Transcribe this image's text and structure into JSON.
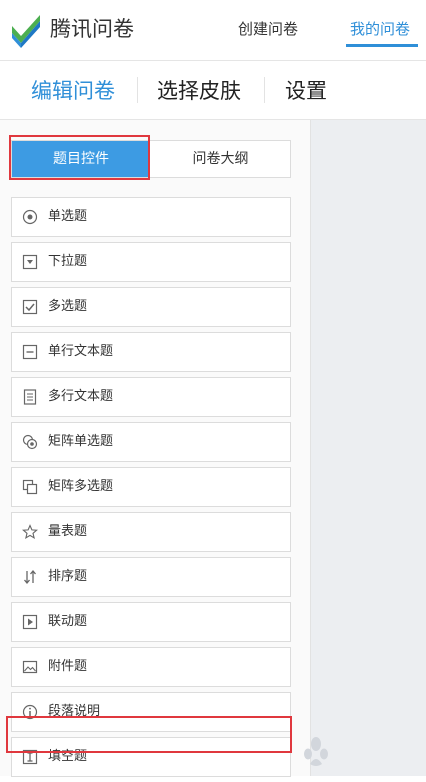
{
  "header": {
    "brand": "腾讯问卷",
    "nav_create": "创建问卷",
    "nav_my": "我的问卷",
    "accent": "#2f8fd8"
  },
  "tabs": [
    {
      "label": "编辑问卷",
      "active": true
    },
    {
      "label": "选择皮肤",
      "active": false
    },
    {
      "label": "设置",
      "active": false
    }
  ],
  "panel_toggle": {
    "active_label": "题目控件",
    "inactive_label": "问卷大纲",
    "active_color": "#3d9be3"
  },
  "question_types": [
    {
      "label": "单选题",
      "icon": "radio-icon"
    },
    {
      "label": "下拉题",
      "icon": "dropdown-icon"
    },
    {
      "label": "多选题",
      "icon": "checkbox-icon"
    },
    {
      "label": "单行文本题",
      "icon": "single-line-text-icon"
    },
    {
      "label": "多行文本题",
      "icon": "multi-line-text-icon"
    },
    {
      "label": "矩阵单选题",
      "icon": "matrix-radio-icon"
    },
    {
      "label": "矩阵多选题",
      "icon": "matrix-checkbox-icon"
    },
    {
      "label": "量表题",
      "icon": "star-icon"
    },
    {
      "label": "排序题",
      "icon": "sort-icon"
    },
    {
      "label": "联动题",
      "icon": "linkage-icon"
    },
    {
      "label": "附件题",
      "icon": "image-icon"
    },
    {
      "label": "段落说明",
      "icon": "info-icon"
    },
    {
      "label": "填空题",
      "icon": "fill-blank-icon"
    }
  ],
  "highlight_color": "#e0383e"
}
